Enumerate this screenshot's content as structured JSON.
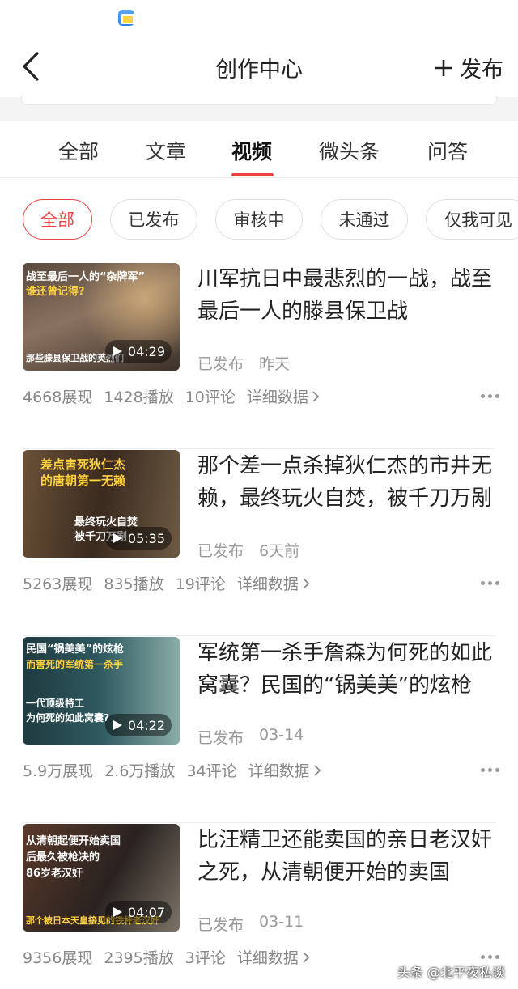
{
  "header": {
    "title": "创作中心",
    "publish_label": "发布"
  },
  "tabs": [
    {
      "label": "全部"
    },
    {
      "label": "文章"
    },
    {
      "label": "视频",
      "active": true
    },
    {
      "label": "微头条"
    },
    {
      "label": "问答"
    }
  ],
  "filters": [
    {
      "label": "全部",
      "active": true
    },
    {
      "label": "已发布"
    },
    {
      "label": "审核中"
    },
    {
      "label": "未通过"
    },
    {
      "label": "仅我可见"
    }
  ],
  "items": [
    {
      "title": "川军抗日中最悲烈的一战，战至最后一人的滕县保卫战",
      "status": "已发布",
      "date": "昨天",
      "duration": "04:29",
      "thumb_lines": [
        "战至最后一人的“杂牌军”",
        "谁还曾记得?",
        "那些滕县保卫战的英烈们"
      ],
      "stats": {
        "impressions": "4668展现",
        "plays": "1428播放",
        "comments": "10评论"
      },
      "detail_label": "详细数据"
    },
    {
      "title": "那个差一点杀掉狄仁杰的市井无赖，最终玩火自焚，被千刀万剐",
      "status": "已发布",
      "date": "6天前",
      "duration": "05:35",
      "thumb_lines": [
        "差点害死狄仁杰",
        "的唐朝第一无赖",
        "最终玩火自焚",
        "被千刀万剐"
      ],
      "stats": {
        "impressions": "5263展现",
        "plays": "835播放",
        "comments": "19评论"
      },
      "detail_label": "详细数据"
    },
    {
      "title": "军统第一杀手詹森为何死的如此窝囊？民国的“锅美美”的炫枪",
      "status": "已发布",
      "date": "03-14",
      "duration": "04:22",
      "thumb_lines": [
        "民国“锅美美”的炫枪",
        "而害死的军统第一杀手",
        "一代顶级特工",
        "为何死的如此窝囊?"
      ],
      "stats": {
        "impressions": "5.9万展现",
        "plays": "2.6万播放",
        "comments": "34评论"
      },
      "detail_label": "详细数据"
    },
    {
      "title": "比汪精卫还能卖国的亲日老汉奸之死，从清朝便开始的卖国",
      "status": "已发布",
      "date": "03-11",
      "duration": "04:07",
      "thumb_lines": [
        "从清朝起便开始卖国",
        "后最久被枪决的",
        "86岁老汉奸",
        "那个被日本天皇接见的铁杆老汉奸"
      ],
      "stats": {
        "impressions": "9356展现",
        "plays": "2395播放",
        "comments": "3评论"
      },
      "detail_label": "详细数据"
    }
  ],
  "watermark": "头条 @北平夜私谈",
  "colors": {
    "accent": "#f04142",
    "muted": "#999999"
  }
}
